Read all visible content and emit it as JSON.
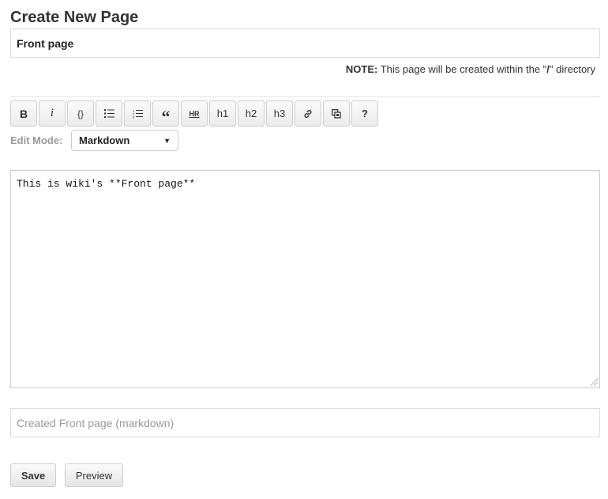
{
  "page": {
    "title": "Create New Page"
  },
  "name_field": {
    "value": "Front page"
  },
  "note": {
    "label": "NOTE:",
    "text_before": "This page will be created within the \"",
    "directory": "/",
    "text_after": "\" directory"
  },
  "toolbar": {
    "buttons": [
      {
        "name": "bold",
        "label": "B"
      },
      {
        "name": "italic",
        "label": "i"
      },
      {
        "name": "code",
        "label": "{}"
      },
      {
        "name": "unordered-list",
        "label": ""
      },
      {
        "name": "ordered-list",
        "label": ""
      },
      {
        "name": "blockquote",
        "label": "“"
      },
      {
        "name": "horizontal-rule",
        "label": "HR"
      },
      {
        "name": "h1",
        "label": "h1"
      },
      {
        "name": "h2",
        "label": "h2"
      },
      {
        "name": "h3",
        "label": "h3"
      },
      {
        "name": "link",
        "label": ""
      },
      {
        "name": "image",
        "label": ""
      },
      {
        "name": "help",
        "label": "?"
      }
    ]
  },
  "edit_mode": {
    "label": "Edit Mode:",
    "selected": "Markdown"
  },
  "editor": {
    "content": "This is wiki's **Front page**"
  },
  "commit_message": {
    "placeholder": "Created Front page (markdown)"
  },
  "actions": {
    "save_label": "Save",
    "preview_label": "Preview"
  }
}
